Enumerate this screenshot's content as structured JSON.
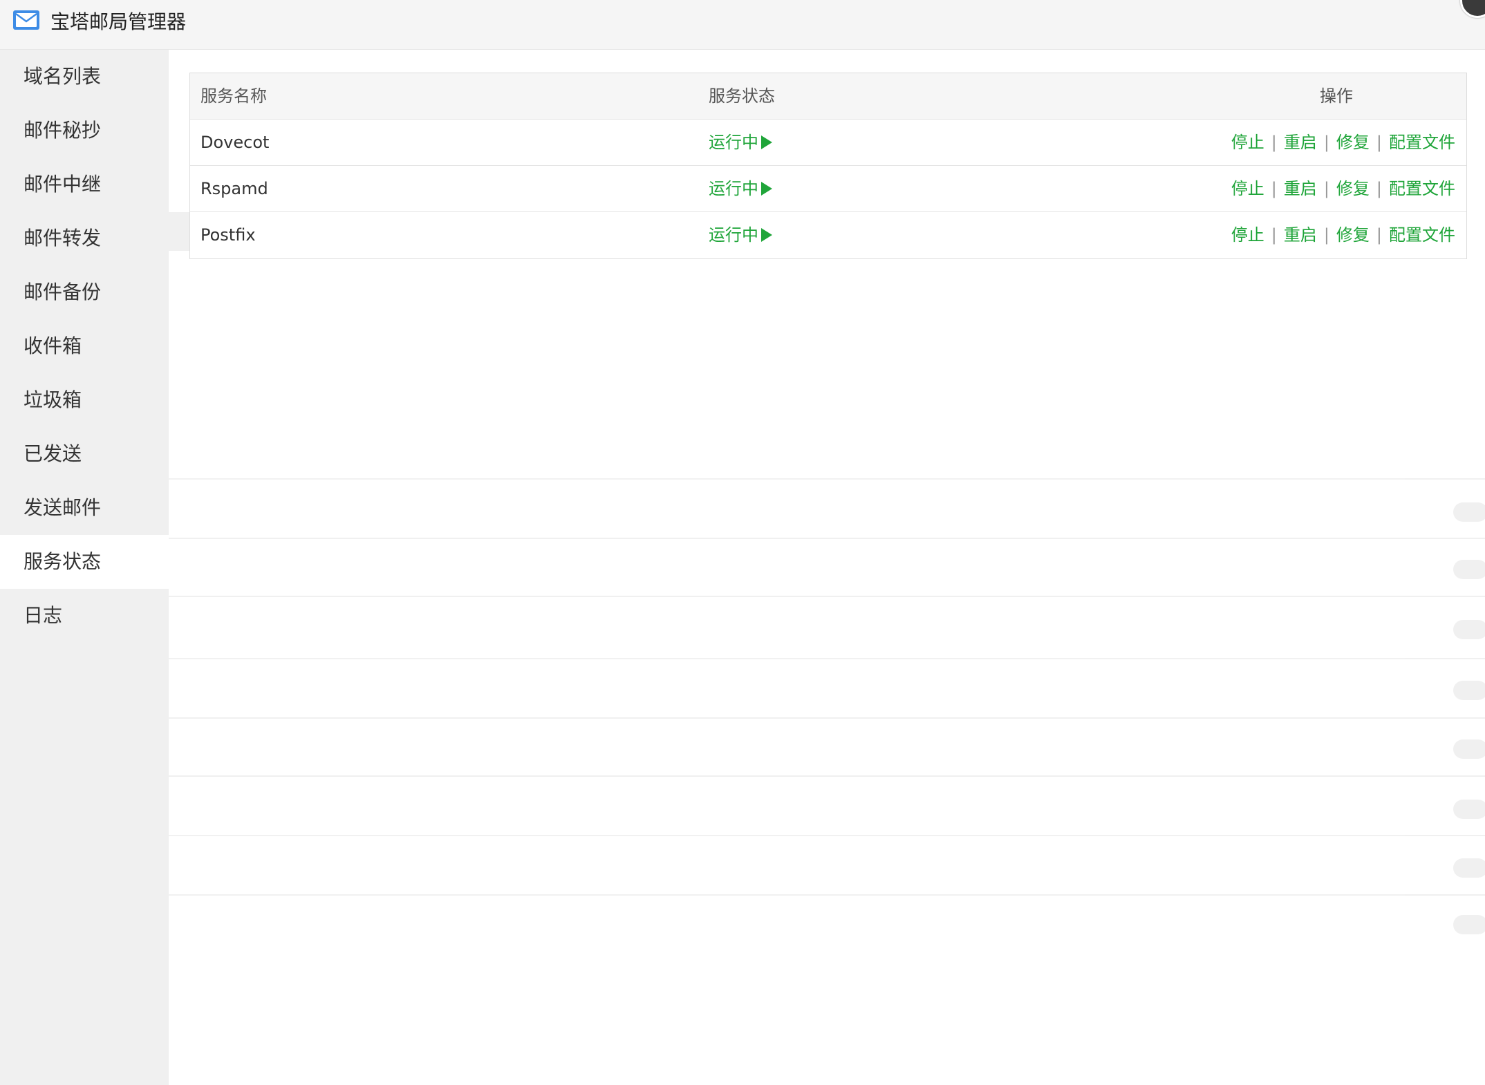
{
  "window": {
    "title": "宝塔邮局管理器",
    "icon": "mail-icon"
  },
  "sidebar": {
    "items": [
      {
        "label": "域名列表"
      },
      {
        "label": "邮件秘抄"
      },
      {
        "label": "邮件中继"
      },
      {
        "label": "邮件转发"
      },
      {
        "label": "邮件备份"
      },
      {
        "label": "收件箱"
      },
      {
        "label": "垃圾箱"
      },
      {
        "label": "已发送"
      },
      {
        "label": "发送邮件"
      },
      {
        "label": "服务状态",
        "active": true
      },
      {
        "label": "日志"
      }
    ]
  },
  "service_table": {
    "headers": {
      "name": "服务名称",
      "status": "服务状态",
      "ops": "操作"
    },
    "rows": [
      {
        "name": "Dovecot",
        "status": "运行中"
      },
      {
        "name": "Rspamd",
        "status": "运行中"
      },
      {
        "name": "Postfix",
        "status": "运行中"
      }
    ],
    "ops": {
      "stop": "停止",
      "restart": "重启",
      "repair": "修复",
      "config": "配置文件",
      "separator": "|"
    }
  },
  "colors": {
    "accent": "#20a53a",
    "sidebar_bg": "#f0f0f0",
    "titlebar_bg": "#f5f5f5"
  }
}
